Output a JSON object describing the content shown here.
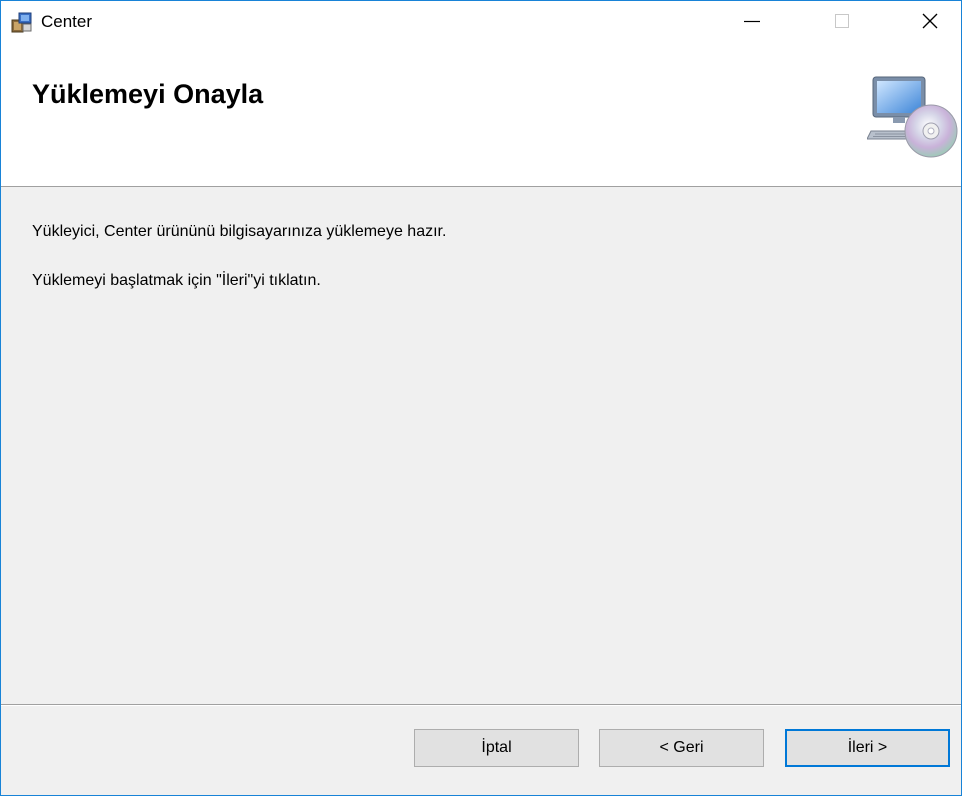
{
  "window": {
    "title": "Center",
    "accent_color": "#1883d7"
  },
  "titlebar_icons": {
    "app": "installer-package-icon",
    "minimize": "minimize-icon",
    "maximize": "maximize-icon",
    "close": "close-icon"
  },
  "header": {
    "title": "Yüklemeyi Onayla",
    "graphic": "computer-with-cd-icon"
  },
  "content": {
    "line1": "Yükleyici, Center ürününü bilgisayarınıza yüklemeye hazır.",
    "line2": "Yüklemeyi başlatmak için \"İleri\"yi tıklatın."
  },
  "buttons": {
    "cancel": "İptal",
    "back": "< Geri",
    "next": "İleri >"
  }
}
